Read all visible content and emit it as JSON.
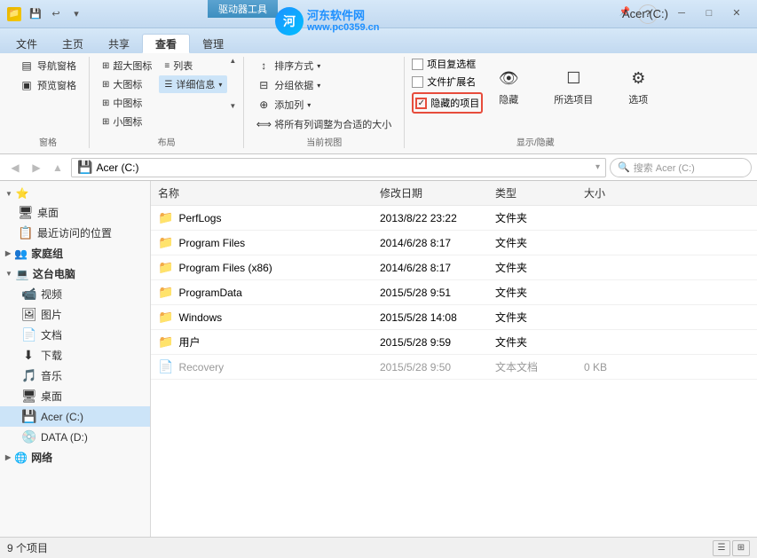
{
  "titleBar": {
    "title": "Acer (C:)",
    "driverTools": "驱动器工具",
    "windowControls": {
      "minimize": "─",
      "maximize": "□",
      "close": "✕"
    }
  },
  "watermark": {
    "siteName": "河东软件网",
    "url": "www.pc0359.cn"
  },
  "ribbon": {
    "tabs": [
      "文件",
      "主页",
      "共享",
      "查看",
      "管理"
    ],
    "activeTab": "查看",
    "groups": {
      "panes": {
        "label": "窗格",
        "items": [
          "导航窗格",
          "预览窗格"
        ]
      },
      "layout": {
        "label": "布局",
        "items": [
          "超大图标",
          "大图标",
          "中图标",
          "小图标",
          "列表",
          "详细信息"
        ]
      },
      "currentView": {
        "label": "当前视图",
        "items": [
          "排序方式",
          "分组依据",
          "添加列",
          "将所有列调整为合适的大小"
        ]
      },
      "showHide": {
        "label": "显示/隐藏",
        "checkboxes": [
          "项目复选框",
          "文件扩展名",
          "隐藏的项目"
        ],
        "checkedItems": [
          "隐藏的项目"
        ],
        "buttons": [
          "隐藏",
          "所选项目",
          "选项"
        ]
      }
    }
  },
  "addressBar": {
    "path": "Acer (C:)",
    "searchPlaceholder": "搜索 Acer (C:)"
  },
  "sidebar": {
    "items": [
      {
        "label": "桌面",
        "type": "recent",
        "indent": 1
      },
      {
        "label": "最近访问的位置",
        "type": "recent",
        "indent": 1
      },
      {
        "label": "家庭组",
        "type": "group",
        "indent": 0
      },
      {
        "label": "这台电脑",
        "type": "computer",
        "indent": 0
      },
      {
        "label": "视频",
        "type": "folder",
        "indent": 1
      },
      {
        "label": "图片",
        "type": "folder",
        "indent": 1
      },
      {
        "label": "文档",
        "type": "folder",
        "indent": 1
      },
      {
        "label": "下载",
        "type": "folder",
        "indent": 1
      },
      {
        "label": "音乐",
        "type": "folder",
        "indent": 1
      },
      {
        "label": "桌面",
        "type": "folder",
        "indent": 1
      },
      {
        "label": "Acer (C:)",
        "type": "drive",
        "indent": 1,
        "active": true
      },
      {
        "label": "DATA (D:)",
        "type": "drive",
        "indent": 1
      },
      {
        "label": "网络",
        "type": "network",
        "indent": 0
      }
    ]
  },
  "fileList": {
    "columns": [
      "名称",
      "修改日期",
      "类型",
      "大小"
    ],
    "files": [
      {
        "name": "PerfLogs",
        "date": "2013/8/22 23:22",
        "type": "文件夹",
        "size": "",
        "isFolder": true,
        "hidden": false
      },
      {
        "name": "Program Files",
        "date": "2014/6/28 8:17",
        "type": "文件夹",
        "size": "",
        "isFolder": true,
        "hidden": false
      },
      {
        "name": "Program Files (x86)",
        "date": "2014/6/28 8:17",
        "type": "文件夹",
        "size": "",
        "isFolder": true,
        "hidden": false
      },
      {
        "name": "ProgramData",
        "date": "2015/5/28 9:51",
        "type": "文件夹",
        "size": "",
        "isFolder": true,
        "hidden": false
      },
      {
        "name": "Windows",
        "date": "2015/5/28 14:08",
        "type": "文件夹",
        "size": "",
        "isFolder": true,
        "hidden": false
      },
      {
        "name": "用户",
        "date": "2015/5/28 9:59",
        "type": "文件夹",
        "size": "",
        "isFolder": true,
        "hidden": false
      },
      {
        "name": "Recovery",
        "date": "2015/5/28 9:50",
        "type": "文本文档",
        "size": "0 KB",
        "isFolder": false,
        "hidden": true
      }
    ]
  },
  "statusBar": {
    "itemCount": "9 个项目"
  }
}
